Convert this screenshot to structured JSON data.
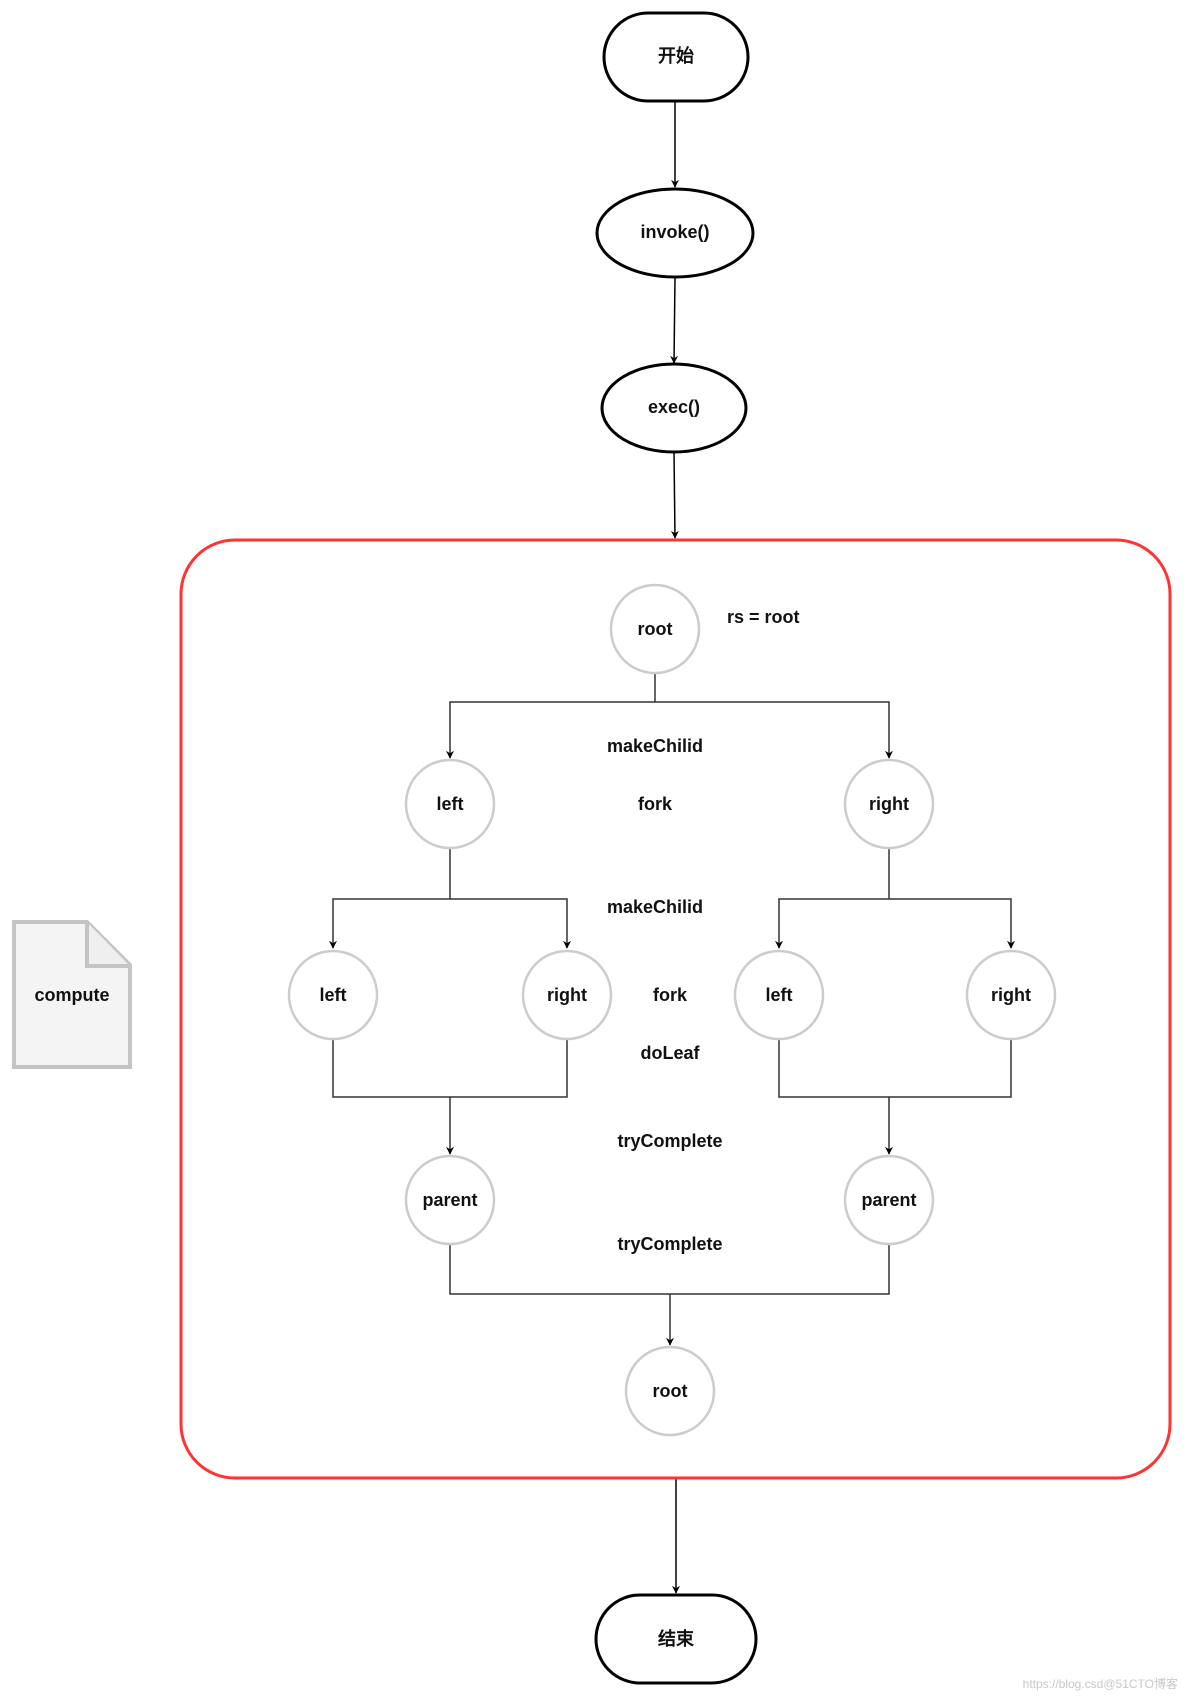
{
  "diagram": {
    "start": {
      "label": "开始"
    },
    "invoke": {
      "label": "invoke()"
    },
    "exec": {
      "label": "exec()"
    },
    "end": {
      "label": "结束"
    },
    "side_document": {
      "label": "compute"
    },
    "container": {
      "border_color": "#FF3333"
    },
    "tree": {
      "root_top": {
        "label": "root"
      },
      "root_note": {
        "label": "rs = root"
      },
      "level1_left": {
        "label": "left"
      },
      "level1_right": {
        "label": "right"
      },
      "level2_left_left": {
        "label": "left"
      },
      "level2_left_right": {
        "label": "right"
      },
      "level2_right_left": {
        "label": "left"
      },
      "level2_right_right": {
        "label": "right"
      },
      "parent_left": {
        "label": "parent"
      },
      "parent_right": {
        "label": "parent"
      },
      "root_bottom": {
        "label": "root"
      }
    },
    "annotations": {
      "make_child_1": "makeChilid",
      "fork_1": "fork",
      "make_child_2": "makeChilid",
      "fork_2": "fork",
      "do_leaf": "doLeaf",
      "try_complete_1": "tryComplete",
      "try_complete_2": "tryComplete"
    },
    "colors": {
      "terminal_stroke": "#000000",
      "tree_node_stroke": "#CCCCCC",
      "connector": "#333333",
      "document_fill": "#F4F4F4",
      "document_stroke": "#C4C4C4"
    }
  },
  "watermark": {
    "text": "https://blog.csd@51CTO博客"
  }
}
